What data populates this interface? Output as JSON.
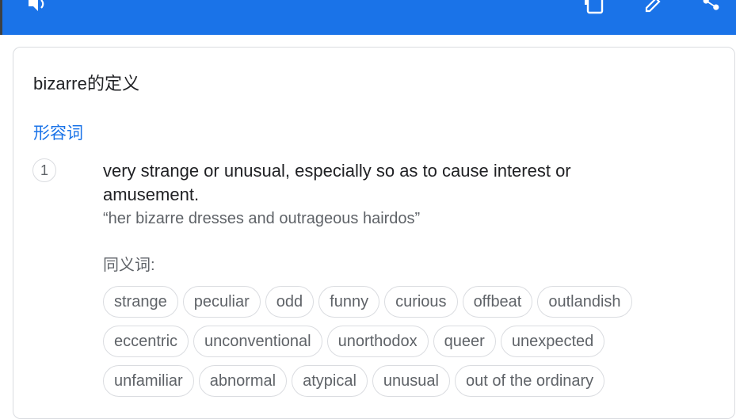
{
  "toolbar": {
    "icons": [
      "speaker-icon",
      "copy-icon",
      "edit-icon",
      "share-icon"
    ]
  },
  "definition_card": {
    "title": "bizarre的定义",
    "part_of_speech": "形容词",
    "sense_number": "1",
    "definition": "very strange or unusual, especially so as to cause interest or amusement.",
    "example": "“her bizarre dresses and outrageous hairdos”",
    "synonyms_label": "同义词:",
    "synonym_rows": [
      [
        "strange",
        "peculiar",
        "odd",
        "funny",
        "curious",
        "offbeat",
        "outlandish"
      ],
      [
        "eccentric",
        "unconventional",
        "unorthodox",
        "queer",
        "unexpected"
      ],
      [
        "unfamiliar",
        "abnormal",
        "atypical",
        "unusual",
        "out of the ordinary"
      ]
    ]
  },
  "colors": {
    "accent": "#1a73e8",
    "chip_border": "#dadce0",
    "secondary_text": "#5f6368",
    "primary_text": "#202124"
  }
}
